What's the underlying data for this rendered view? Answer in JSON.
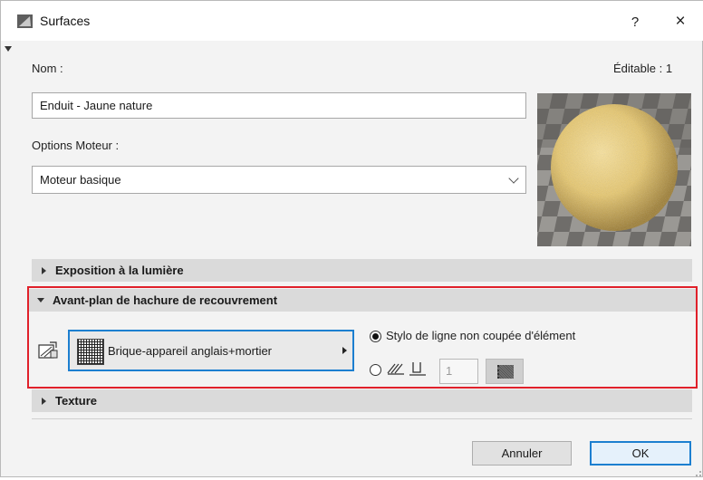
{
  "window": {
    "title": "Surfaces",
    "help_label": "?",
    "close_label": "×"
  },
  "form": {
    "name_label": "Nom :",
    "editable_label": "Éditable : 1",
    "name_value": "Enduit - Jaune nature",
    "engine_label": "Options Moteur :",
    "engine_value": "Moteur basique"
  },
  "sections": {
    "exposure": "Exposition à la lumière",
    "hatch": "Avant-plan de hachure de recouvrement",
    "texture": "Texture"
  },
  "hatch_panel": {
    "pattern_name": "Brique-appareil anglais+mortier",
    "option_element_pen": "Stylo de ligne non coupée d'élément",
    "pen_number": "1",
    "selected_option": "element_pen"
  },
  "buttons": {
    "cancel": "Annuler",
    "ok": "OK"
  },
  "colors": {
    "highlight": "#e0202a",
    "accent": "#1c7fd0",
    "sphere": "#e8c76a"
  }
}
